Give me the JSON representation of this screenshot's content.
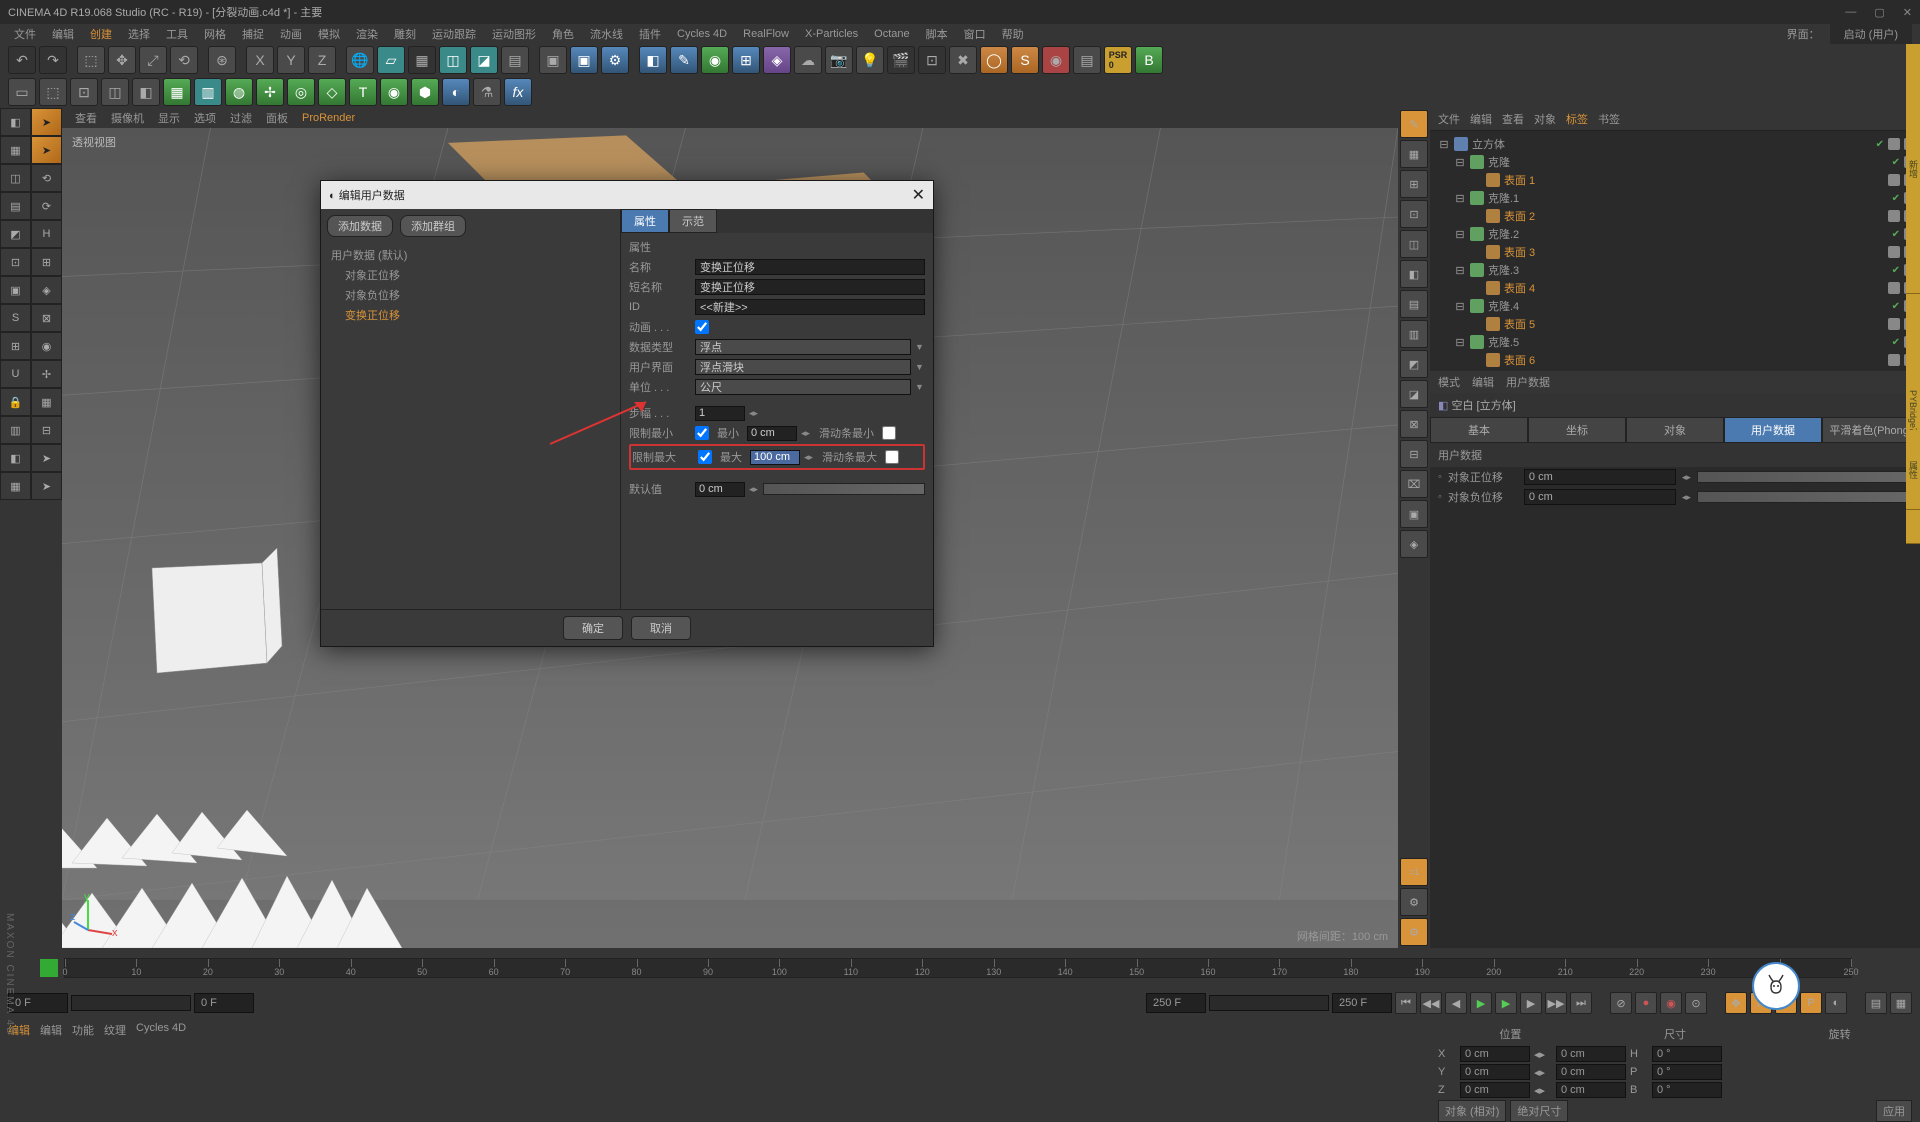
{
  "titlebar": {
    "title": "CINEMA 4D R19.068 Studio (RC - R19) - [分裂动画.c4d *] - 主要"
  },
  "main_menu": [
    "文件",
    "编辑",
    "创建",
    "选择",
    "工具",
    "网格",
    "捕捉",
    "动画",
    "模拟",
    "渲染",
    "雕刻",
    "运动跟踪",
    "运动图形",
    "角色",
    "流水线",
    "插件",
    "Cycles 4D",
    "RealFlow",
    "X-Particles",
    "Octane",
    "脚本",
    "窗口",
    "帮助"
  ],
  "main_menu_highlight_idx": 2,
  "layout": {
    "label": "界面：",
    "value": "启动 (用户)"
  },
  "viewport_menu": [
    "查看",
    "摄像机",
    "显示",
    "选项",
    "过滤",
    "面板",
    "ProRender"
  ],
  "viewport_label": "透视视图",
  "grid_info": "网格间距：100 cm",
  "right_panel": {
    "tabs_top": [
      "文件",
      "编辑",
      "查看",
      "对象",
      "标签",
      "书签"
    ],
    "tree": [
      {
        "level": 0,
        "expand": "⊟",
        "icon": "cube",
        "label": "立方体",
        "tags": 2,
        "check": true
      },
      {
        "level": 1,
        "expand": "⊟",
        "icon": "clone",
        "label": "克隆",
        "tags": 1,
        "check": true
      },
      {
        "level": 2,
        "expand": "",
        "icon": "surface",
        "label": "表面 1",
        "tags": 2,
        "check": false
      },
      {
        "level": 1,
        "expand": "⊟",
        "icon": "clone",
        "label": "克隆.1",
        "tags": 1,
        "check": true
      },
      {
        "level": 2,
        "expand": "",
        "icon": "surface",
        "label": "表面 2",
        "tags": 2,
        "check": false
      },
      {
        "level": 1,
        "expand": "⊟",
        "icon": "clone",
        "label": "克隆.2",
        "tags": 1,
        "check": true
      },
      {
        "level": 2,
        "expand": "",
        "icon": "surface",
        "label": "表面 3",
        "tags": 2,
        "check": false
      },
      {
        "level": 1,
        "expand": "⊟",
        "icon": "clone",
        "label": "克隆.3",
        "tags": 1,
        "check": true
      },
      {
        "level": 2,
        "expand": "",
        "icon": "surface",
        "label": "表面 4",
        "tags": 2,
        "check": false
      },
      {
        "level": 1,
        "expand": "⊟",
        "icon": "clone",
        "label": "克隆.4",
        "tags": 1,
        "check": true
      },
      {
        "level": 2,
        "expand": "",
        "icon": "surface",
        "label": "表面 5",
        "tags": 2,
        "check": false
      },
      {
        "level": 1,
        "expand": "⊟",
        "icon": "clone",
        "label": "克隆.5",
        "tags": 1,
        "check": true
      },
      {
        "level": 2,
        "expand": "",
        "icon": "surface",
        "label": "表面 6",
        "tags": 2,
        "check": false
      }
    ]
  },
  "attr_panel": {
    "menu": [
      "模式",
      "编辑",
      "用户数据"
    ],
    "title_prefix": "空白 ",
    "title": "[立方体]",
    "tabs": [
      "基本",
      "坐标",
      "对象",
      "用户数据",
      "平滑着色(Phong)"
    ],
    "active_tab_idx": 3,
    "section": "用户数据",
    "rows": [
      {
        "label": "对象正位移",
        "value": "0 cm"
      },
      {
        "label": "对象负位移",
        "value": "0 cm"
      }
    ]
  },
  "timeline": {
    "start": 0,
    "end": 250,
    "step": 10
  },
  "playback": {
    "cur": "0 F",
    "range_start": "0 F",
    "range_end": "250 F",
    "total": "250 F"
  },
  "bottom_left_menu": [
    "编辑",
    "编辑",
    "功能",
    "纹理",
    "Cycles 4D"
  ],
  "coords": {
    "headers": [
      "位置",
      "尺寸",
      "旋转"
    ],
    "rows": [
      {
        "axis": "X",
        "pos": "0 cm",
        "size": "0 cm",
        "rotlabel": "H",
        "rot": "0 °"
      },
      {
        "axis": "Y",
        "pos": "0 cm",
        "size": "0 cm",
        "rotlabel": "P",
        "rot": "0 °"
      },
      {
        "axis": "Z",
        "pos": "0 cm",
        "size": "0 cm",
        "rotlabel": "B",
        "rot": "0 °"
      }
    ],
    "dropdown1": "对象 (相对)",
    "dropdown2": "绝对尺寸",
    "apply": "应用"
  },
  "dialog": {
    "title": "编辑用户数据",
    "btn_add_data": "添加数据",
    "btn_add_group": "添加群组",
    "tree_root": "用户数据 (默认)",
    "tree_items": [
      "对象正位移",
      "对象负位移",
      "变换正位移"
    ],
    "tree_selected_idx": 2,
    "tab_attr": "属性",
    "tab_example": "示范",
    "section": "属性",
    "fields": {
      "name_label": "名称",
      "name_value": "变换正位移",
      "short_label": "短名称",
      "short_value": "变换正位移",
      "id_label": "ID",
      "id_value": "<<新建>>",
      "anim_label": "动画 . . .",
      "anim_checked": true,
      "datatype_label": "数据类型",
      "datatype_value": "浮点",
      "ui_label": "用户界面",
      "ui_value": "浮点滑块",
      "unit_label": "单位 . . .",
      "unit_value": "公尺",
      "step_label": "步幅 . . .",
      "step_value": "1",
      "limit_min_label": "限制最小",
      "limit_min_checked": true,
      "min_label": "最小",
      "min_value": "0 cm",
      "slider_min_label": "滑动条最小",
      "limit_max_label": "限制最大",
      "limit_max_checked": true,
      "max_label": "最大",
      "max_value": "100 cm",
      "slider_max_label": "滑动条最大",
      "default_label": "默认值",
      "default_value": "0 cm"
    },
    "ok": "确定",
    "cancel": "取消"
  },
  "side_strip": [
    "新增",
    "PYBridge对接"
  ],
  "side_strip2": "属性",
  "watermark": "小鹿"
}
